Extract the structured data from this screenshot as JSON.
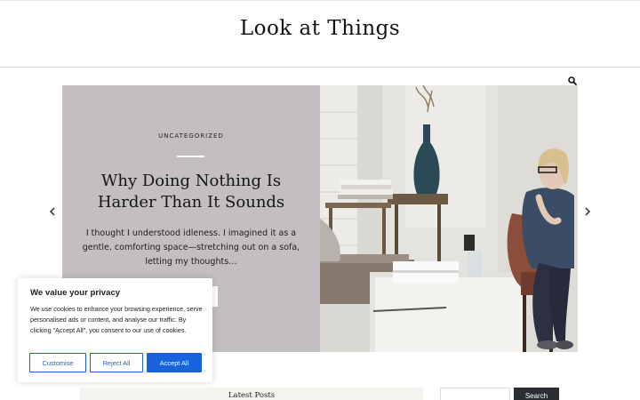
{
  "site": {
    "title": "Look at Things"
  },
  "header": {
    "search_icon": "search-icon"
  },
  "slider": {
    "category": "UNCATEGORIZED",
    "title": "Why Doing Nothing Is Harder Than It Sounds",
    "excerpt": "I thought I understood idleness. I imagined it as a gentle, comforting space—stretching out on a sofa, letting my thoughts…",
    "prev_icon": "chevron-left-icon",
    "next_icon": "chevron-right-icon",
    "image": "interior-woman-seated-photo",
    "panel_color": "#c2bec2"
  },
  "sidebar": {
    "latest_posts_title": "Latest Posts",
    "search_button_label": "Search",
    "search_placeholder": ""
  },
  "cookie_banner": {
    "title": "We value your privacy",
    "text": "We use cookies to enhance your browsing experience, serve personalised ads or content, and analyse our traffic. By clicking \"Accept All\", you consent to our use of cookies.",
    "customise_label": "Customise",
    "reject_label": "Reject All",
    "accept_label": "Accept All",
    "accent_color": "#1863dc"
  }
}
